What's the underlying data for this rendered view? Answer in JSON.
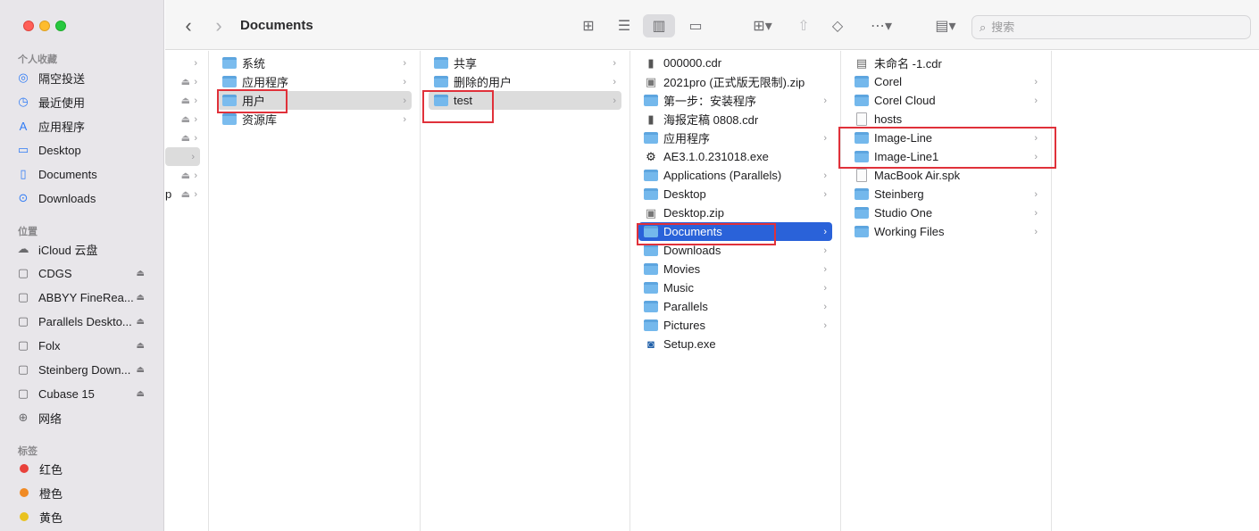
{
  "toolbar": {
    "title": "Documents",
    "back_glyph": "‹",
    "forward_glyph": "›",
    "search_placeholder": "搜索"
  },
  "sidebar": {
    "section_favorites": "个人收藏",
    "favorites": [
      {
        "label": "隔空投送",
        "icon": "airdrop-icon"
      },
      {
        "label": "最近使用",
        "icon": "clock-icon"
      },
      {
        "label": "应用程序",
        "icon": "applications-icon"
      },
      {
        "label": "Desktop",
        "icon": "desktop-icon"
      },
      {
        "label": "Documents",
        "icon": "document-icon"
      },
      {
        "label": "Downloads",
        "icon": "download-icon"
      }
    ],
    "section_locations": "位置",
    "locations": [
      {
        "label": "iCloud 云盘",
        "icon": "cloud-icon"
      },
      {
        "label": "CDGS",
        "icon": "disk-icon"
      },
      {
        "label": "ABBYY FineRea...",
        "icon": "disk-icon"
      },
      {
        "label": "Parallels Deskto...",
        "icon": "disk-icon"
      },
      {
        "label": "Folx",
        "icon": "disk-icon"
      },
      {
        "label": "Steinberg Down...",
        "icon": "disk-icon"
      },
      {
        "label": "Cubase 15",
        "icon": "disk-icon"
      },
      {
        "label": "网络",
        "icon": "network-icon"
      }
    ],
    "section_tags": "标签",
    "tags": [
      {
        "label": "红色",
        "color": "#e8413b"
      },
      {
        "label": "橙色",
        "color": "#f08a24"
      },
      {
        "label": "黄色",
        "color": "#e9c220"
      }
    ]
  },
  "col0": {
    "partial_label": "p"
  },
  "col1": {
    "items": [
      {
        "label": "系统"
      },
      {
        "label": "应用程序"
      },
      {
        "label": "用户"
      },
      {
        "label": "资源库"
      }
    ]
  },
  "col2": {
    "items": [
      {
        "label": "共享"
      },
      {
        "label": "删除的用户"
      },
      {
        "label": "test"
      }
    ]
  },
  "col3": {
    "items": [
      {
        "label": "000000.cdr"
      },
      {
        "label": "2021pro (正式版无限制).zip"
      },
      {
        "label": "第一步：安装程序"
      },
      {
        "label": "海报定稿 0808.cdr"
      },
      {
        "label": "应用程序"
      },
      {
        "label": "AE3.1.0.231018.exe"
      },
      {
        "label": "Applications (Parallels)"
      },
      {
        "label": "Desktop"
      },
      {
        "label": "Desktop.zip"
      },
      {
        "label": "Documents"
      },
      {
        "label": "Downloads"
      },
      {
        "label": "Movies"
      },
      {
        "label": "Music"
      },
      {
        "label": "Parallels"
      },
      {
        "label": "Pictures"
      },
      {
        "label": "Setup.exe"
      }
    ]
  },
  "col4": {
    "items": [
      {
        "label": "未命名 -1.cdr"
      },
      {
        "label": "Corel"
      },
      {
        "label": "Corel Cloud"
      },
      {
        "label": "hosts"
      },
      {
        "label": "Image-Line"
      },
      {
        "label": "Image-Line1"
      },
      {
        "label": "MacBook Air.spk"
      },
      {
        "label": "Steinberg"
      },
      {
        "label": "Studio One"
      },
      {
        "label": "Working Files"
      }
    ]
  },
  "chevron_glyph": "›",
  "eject_glyph": "⏏"
}
